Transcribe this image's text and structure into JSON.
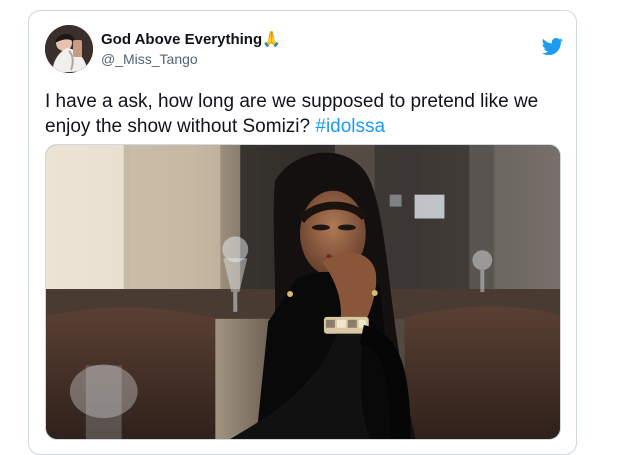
{
  "tweet": {
    "display_name": "God Above Everything",
    "handle": "@_Miss_Tango",
    "text": "I have a ask, how long are we supposed to pretend like we enjoy the show without Somizi? ",
    "hashtag": "#idolssa",
    "avatar_icon": "profile-photo",
    "name_emoji": "🙏",
    "brand_icon": "twitter-bird-icon",
    "brand_color": "#1d9bf0"
  },
  "media": {
    "description_icon": "tweet-photo"
  }
}
